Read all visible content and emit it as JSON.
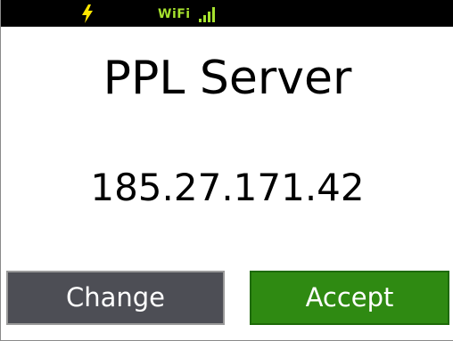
{
  "status_bar": {
    "charging_icon": "lightning-bolt-icon",
    "wifi_label": "WiFi",
    "signal_icon": "signal-bars-icon",
    "accent_color": "#a6e22e",
    "bolt_color": "#ffe600"
  },
  "screen": {
    "title": "PPL Server",
    "server_address": "185.27.171.42"
  },
  "buttons": {
    "change_label": "Change",
    "accept_label": "Accept",
    "change_color": "#4d4e55",
    "accept_color": "#2f8a12"
  }
}
